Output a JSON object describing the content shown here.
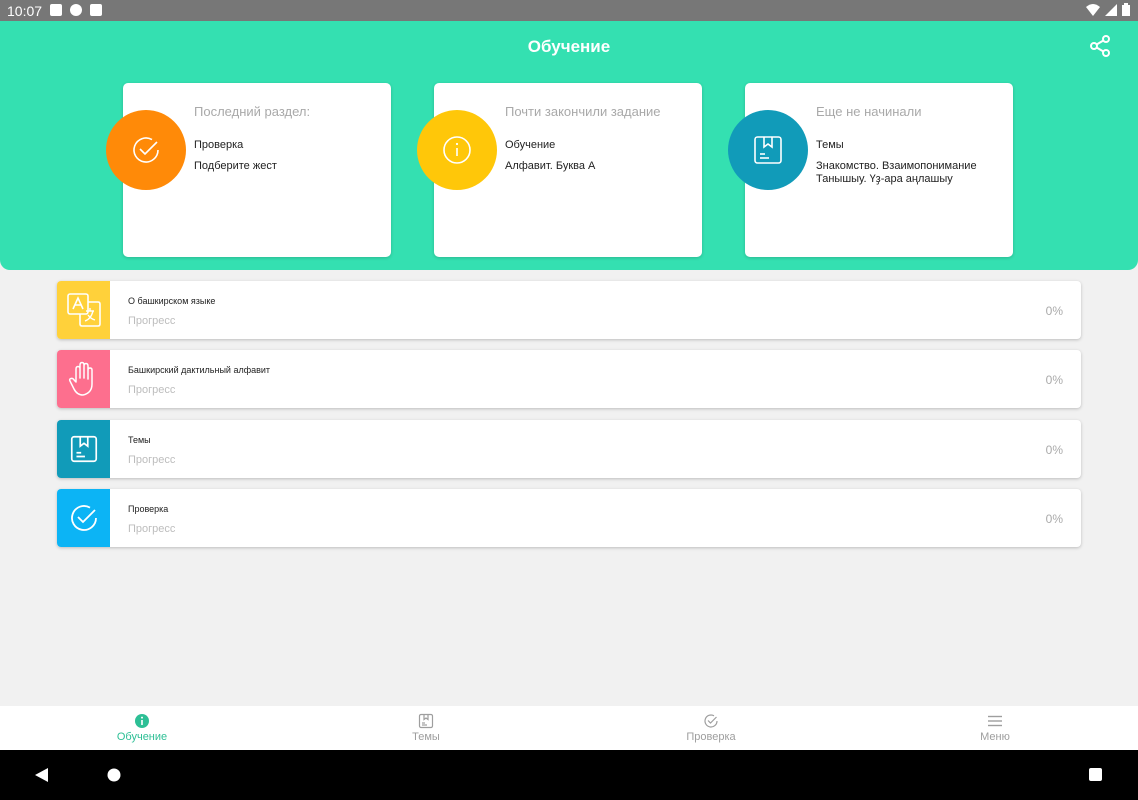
{
  "status_bar": {
    "time": "10:07"
  },
  "header": {
    "title": "Обучение"
  },
  "cards": [
    {
      "title": "Последний раздел:",
      "line1": "Проверка",
      "line2": "Подберите жест",
      "color": "#ff8a08",
      "icon": "check-circle-icon"
    },
    {
      "title": "Почти закончили задание",
      "line1": "Обучение",
      "line2": "Алфавит. Буква А",
      "color": "#ffc709",
      "icon": "info-circle-icon"
    },
    {
      "title": "Еще не начинали",
      "line1": "Темы",
      "line2": "Знакомство. Взаимопонимание Танышыу. Үҙ-ара аңлашыу",
      "color": "#119bb9",
      "icon": "bookmark-box-icon"
    }
  ],
  "sections": [
    {
      "title": "О башкирском языке",
      "progress_label": "Прогресс",
      "percent": "0%",
      "color": "#ffd13a",
      "icon": "translate-icon"
    },
    {
      "title": "Башкирский дактильный алфавит",
      "progress_label": "Прогресс",
      "percent": "0%",
      "color": "#fd6f8e",
      "icon": "hand-icon"
    },
    {
      "title": "Темы",
      "progress_label": "Прогресс",
      "percent": "0%",
      "color": "#119bb9",
      "icon": "bookmark-box-icon"
    },
    {
      "title": "Проверка",
      "progress_label": "Прогресс",
      "percent": "0%",
      "color": "#0cb4f5",
      "icon": "check-circle-icon"
    }
  ],
  "bottom_nav": [
    {
      "label": "Обучение",
      "icon": "info-icon",
      "active": true
    },
    {
      "label": "Темы",
      "icon": "bookmark-box-icon",
      "active": false
    },
    {
      "label": "Проверка",
      "icon": "check-circle-icon",
      "active": false
    },
    {
      "label": "Меню",
      "icon": "menu-icon",
      "active": false
    }
  ],
  "colors": {
    "accent": "#34e0b1",
    "active_nav": "#2dbf95"
  }
}
